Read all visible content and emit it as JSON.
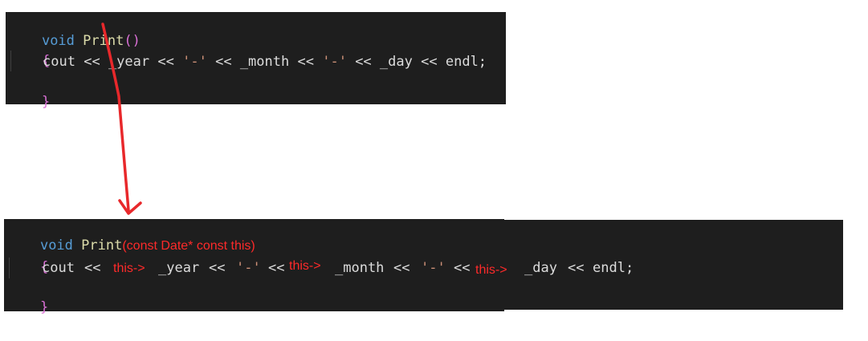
{
  "top": {
    "kw_void": "void",
    "fn_name": "Print",
    "open_paren": "(",
    "close_paren": ")",
    "open_brace": "{",
    "close_brace": "}",
    "body_cout": "cout",
    "op1": "<<",
    "var_year": "_year",
    "op2": "<<",
    "str1": "'-'",
    "op3": "<<",
    "var_month": "_month",
    "op4": "<<",
    "str2": "'-'",
    "op5": "<<",
    "var_day": "_day",
    "op6": "<<",
    "endl": "endl;"
  },
  "bottom": {
    "kw_void": "void",
    "fn_name": "Print",
    "param_open": "(",
    "param_text": "const Date* const this",
    "param_close": ")",
    "open_brace": "{",
    "close_brace": "}",
    "body_cout": "cout",
    "op1": "<<",
    "this1": "this->",
    "var_year": "_year",
    "op2": "<<",
    "str1": "'-'",
    "op3": "<<",
    "this2": "this->",
    "var_month": "_month",
    "op4": "<<",
    "str2": "'-'",
    "op5": "<<",
    "this3": "this->",
    "var_day": "_day",
    "op6": "<<",
    "endl": "endl;"
  },
  "colors": {
    "editor_bg": "#1e1e1e",
    "keyword": "#569cd6",
    "function": "#dcdcaa",
    "bracket": "#da70d6",
    "string": "#ce9178",
    "annotation": "#ff2a2a"
  }
}
